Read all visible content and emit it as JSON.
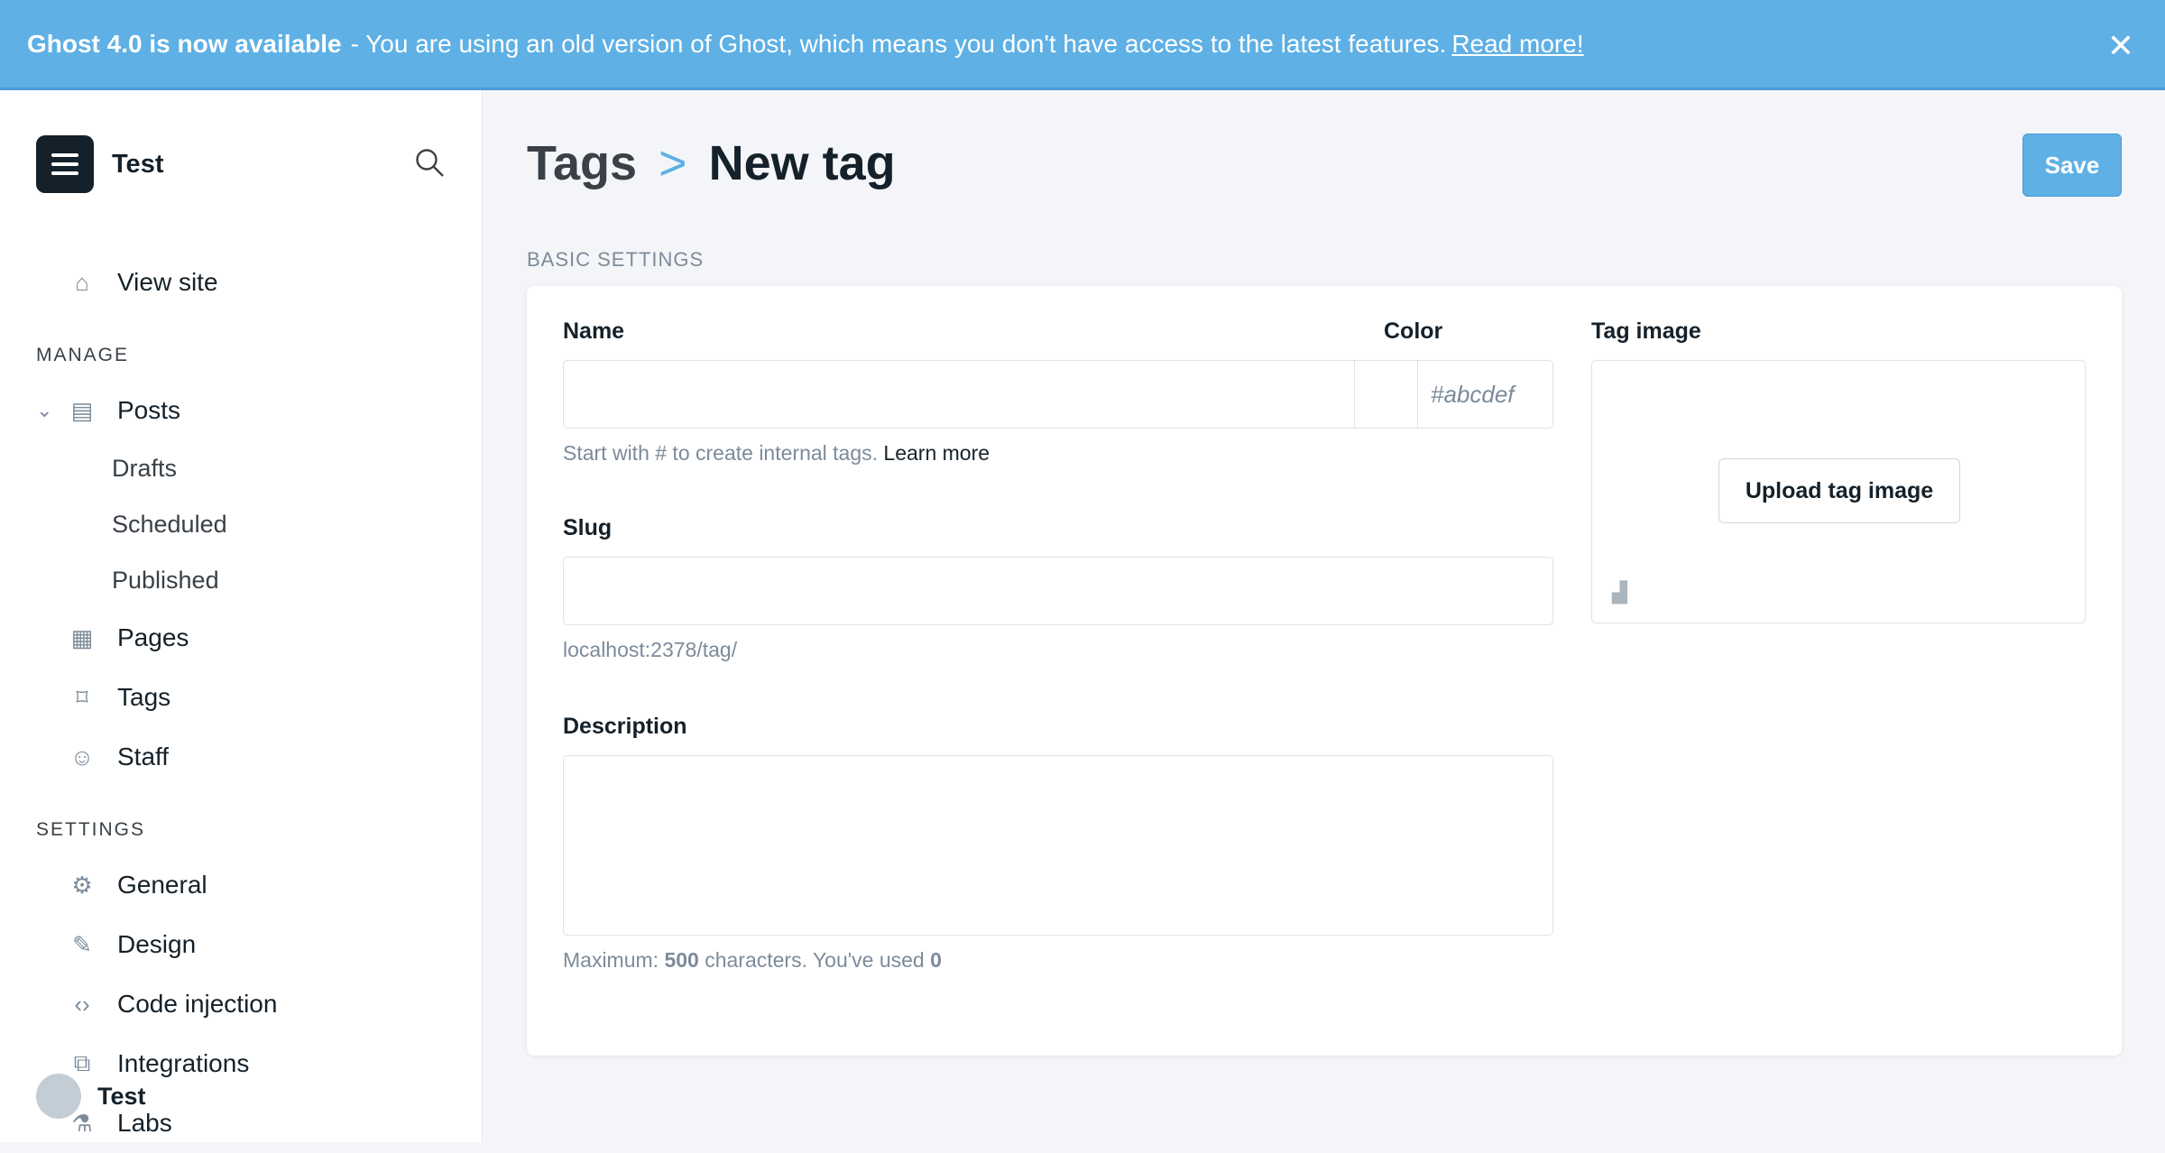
{
  "banner": {
    "title": "Ghost 4.0 is now available",
    "message": "- You are using an old version of Ghost, which means you don't have access to the latest features.",
    "link": "Read more!"
  },
  "sidebar": {
    "site_name": "Test",
    "view_site": "View site",
    "manage_label": "MANAGE",
    "settings_label": "SETTINGS",
    "posts": "Posts",
    "post_subs": [
      "Drafts",
      "Scheduled",
      "Published"
    ],
    "manage": [
      "Pages",
      "Tags",
      "Staff"
    ],
    "settings": [
      "General",
      "Design",
      "Code injection",
      "Integrations",
      "Labs"
    ],
    "user": "Test"
  },
  "header": {
    "parent": "Tags",
    "separator": ">",
    "title": "New tag",
    "save": "Save"
  },
  "form": {
    "section": "BASIC SETTINGS",
    "name_label": "Name",
    "name_value": "",
    "color_label": "Color",
    "color_placeholder": "#abcdef",
    "name_help": "Start with # to create internal tags.",
    "name_help_link": "Learn more",
    "slug_label": "Slug",
    "slug_value": "",
    "slug_url": "localhost:2378/tag/",
    "description_label": "Description",
    "description_value": "",
    "description_help": "Maximum: ",
    "description_max": "500",
    "description_help2": " characters. You've used ",
    "description_used": "0",
    "tag_image_label": "Tag image",
    "upload_button": "Upload tag image"
  }
}
